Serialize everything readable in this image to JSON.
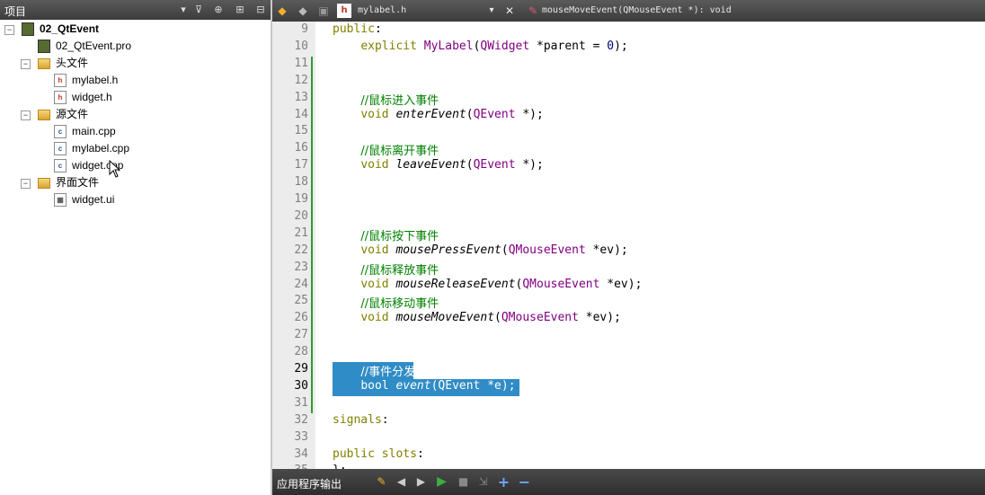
{
  "left_panel": {
    "title": "项目"
  },
  "tree": {
    "project": "02_QtEvent",
    "pro_file": "02_QtEvent.pro",
    "headers_folder": "头文件",
    "headers": [
      "mylabel.h",
      "widget.h"
    ],
    "sources_folder": "源文件",
    "sources": [
      "main.cpp",
      "mylabel.cpp",
      "widget.cpp"
    ],
    "forms_folder": "界面文件",
    "forms": [
      "widget.ui"
    ]
  },
  "editor": {
    "file_name": "mylabel.h",
    "symbol": "mouseMoveEvent(QMouseEvent *): void",
    "selected_lines": [
      29,
      30
    ],
    "lines": [
      {
        "n": "9",
        "text": "public:"
      },
      {
        "n": "10",
        "text": "    explicit MyLabel(QWidget *parent = 0);"
      },
      {
        "n": "11",
        "text": ""
      },
      {
        "n": "12",
        "text": ""
      },
      {
        "n": "13",
        "text": "    //鼠标进入事件"
      },
      {
        "n": "14",
        "text": "    void enterEvent(QEvent *);"
      },
      {
        "n": "15",
        "text": ""
      },
      {
        "n": "16",
        "text": "    //鼠标离开事件"
      },
      {
        "n": "17",
        "text": "    void leaveEvent(QEvent *);"
      },
      {
        "n": "18",
        "text": ""
      },
      {
        "n": "19",
        "text": ""
      },
      {
        "n": "20",
        "text": ""
      },
      {
        "n": "21",
        "text": "    //鼠标按下事件"
      },
      {
        "n": "22",
        "text": "    void mousePressEvent(QMouseEvent *ev);"
      },
      {
        "n": "23",
        "text": "    //鼠标释放事件"
      },
      {
        "n": "24",
        "text": "    void mouseReleaseEvent(QMouseEvent *ev);"
      },
      {
        "n": "25",
        "text": "    //鼠标移动事件"
      },
      {
        "n": "26",
        "text": "    void mouseMoveEvent(QMouseEvent *ev);"
      },
      {
        "n": "27",
        "text": ""
      },
      {
        "n": "28",
        "text": ""
      },
      {
        "n": "29",
        "text": "    //事件分发器"
      },
      {
        "n": "30",
        "text": "    bool event(QEvent *e);"
      },
      {
        "n": "31",
        "text": ""
      },
      {
        "n": "32",
        "text": "signals:"
      },
      {
        "n": "33",
        "text": ""
      },
      {
        "n": "34",
        "text": "public slots:"
      },
      {
        "n": "35",
        "text": "};"
      }
    ]
  },
  "output_bar": {
    "title": "应用程序输出"
  },
  "colors": {
    "selection": "#308cc6",
    "keyword": "#808000",
    "type": "#800080",
    "comment": "#008000",
    "change_bar": "#2f9a2f"
  }
}
